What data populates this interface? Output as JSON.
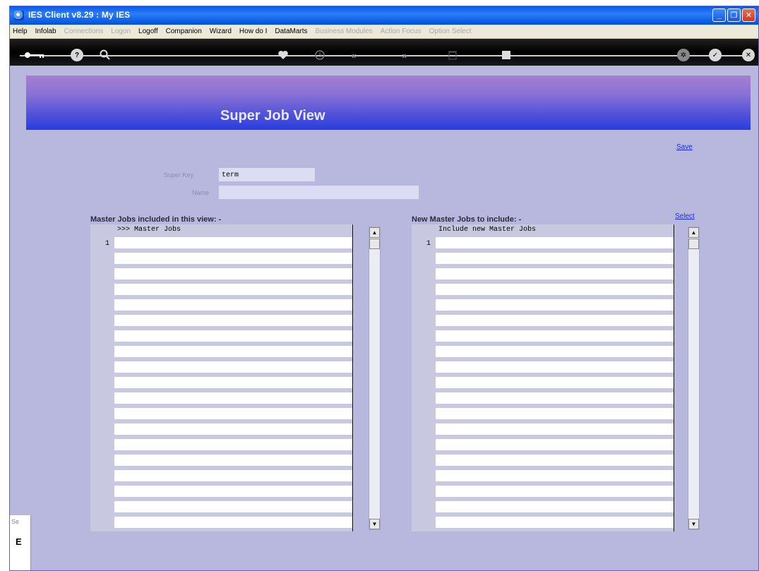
{
  "window": {
    "title": "IES Client v8.29 : My IES"
  },
  "menu": [
    {
      "label": "Help",
      "disabled": false
    },
    {
      "label": "Infolab",
      "disabled": false
    },
    {
      "label": "Connections",
      "disabled": true
    },
    {
      "label": "Logon",
      "disabled": true
    },
    {
      "label": "Logoff",
      "disabled": false
    },
    {
      "label": "Companion",
      "disabled": false
    },
    {
      "label": "Wizard",
      "disabled": false
    },
    {
      "label": "How do I",
      "disabled": false
    },
    {
      "label": "DataMarts",
      "disabled": false
    },
    {
      "label": "Business Modules",
      "disabled": true
    },
    {
      "label": "Action Focus",
      "disabled": true
    },
    {
      "label": "Option Select",
      "disabled": true
    }
  ],
  "toolbar": {
    "icons": [
      "key-icon",
      "help-icon",
      "search-icon",
      "heart-icon",
      "clock-icon",
      "back-icon",
      "forward-icon",
      "trash-icon",
      "stop-icon",
      "config-icon",
      "ok-icon",
      "close-icon"
    ]
  },
  "page": {
    "heading": "Super Job View",
    "save_link": "Save",
    "select_link": "Select",
    "super_key_label": "Super Key",
    "super_key_value": "term",
    "name_label": "Name",
    "name_value": ""
  },
  "left_grid": {
    "title": "Master Jobs included in this view: -",
    "column_header": ">>> Master Jobs",
    "first_row_num": "1"
  },
  "right_grid": {
    "title": "New Master Jobs to include: -",
    "column_header": "Include new Master Jobs",
    "first_row_num": "1"
  },
  "status": {
    "fragment_1": "Se",
    "fragment_2": "E"
  }
}
